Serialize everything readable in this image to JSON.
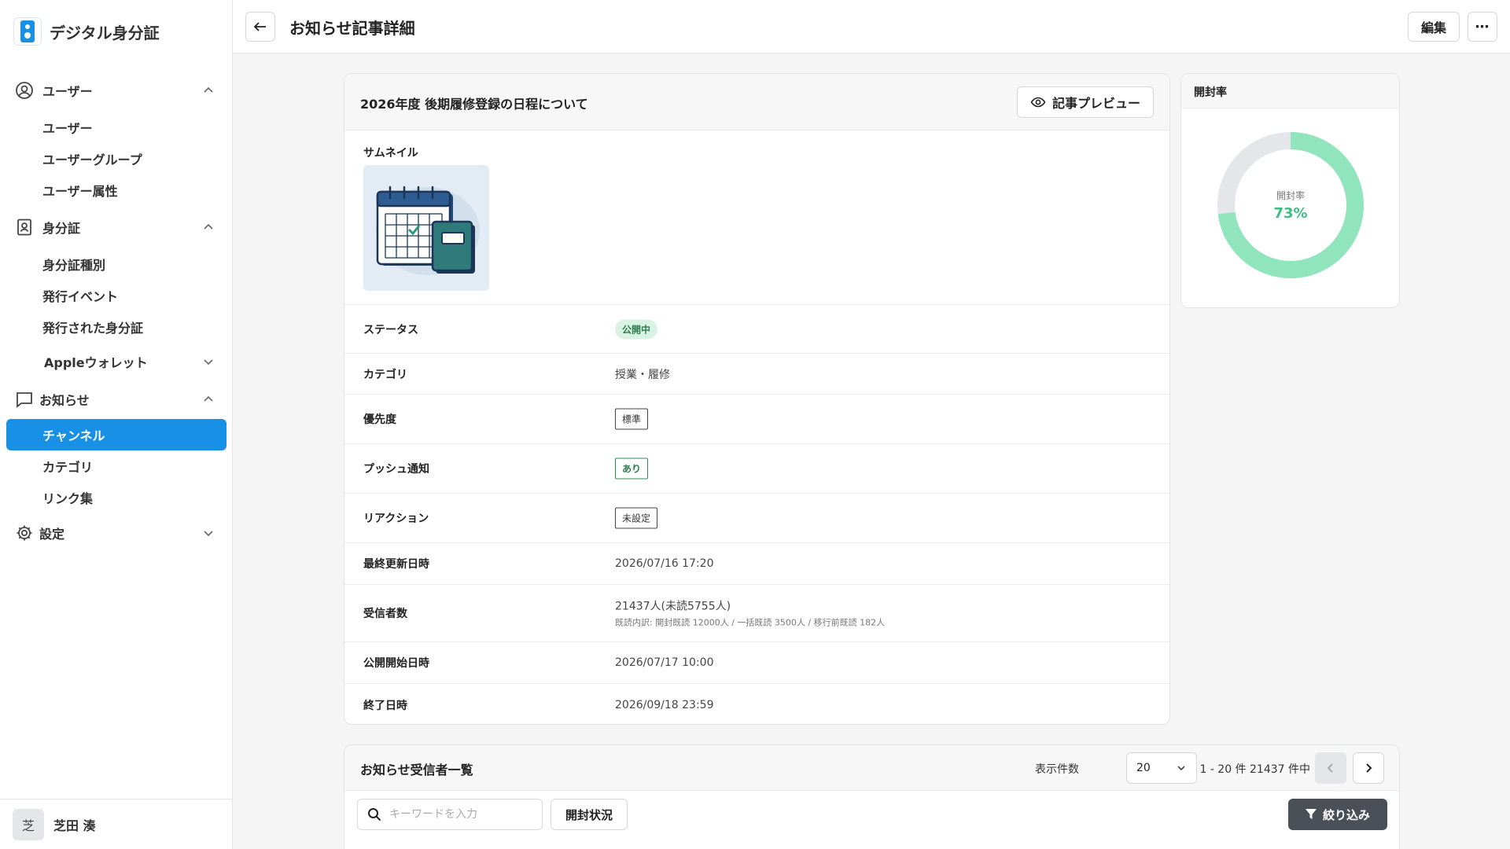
{
  "brand": {
    "name": "デジタル身分証"
  },
  "sidebar": {
    "sections": [
      {
        "label": "ユーザー",
        "icon": "user-circle-icon",
        "expanded": true
      },
      {
        "label": "身分証",
        "icon": "id-badge-icon",
        "expanded": true
      },
      {
        "label": "お知らせ",
        "icon": "message-icon",
        "expanded": true
      },
      {
        "label": "設定",
        "icon": "gear-icon",
        "expanded": false
      }
    ],
    "users_items": [
      "ユーザー",
      "ユーザーグループ",
      "ユーザー属性"
    ],
    "id_items": [
      "身分証種別",
      "発行イベント",
      "発行された身分証"
    ],
    "apple_wallet": "Appleウォレット",
    "notice_items": [
      "チャンネル",
      "カテゴリ",
      "リンク集"
    ],
    "active_item": "チャンネル",
    "accent_color": "#1890e6"
  },
  "user": {
    "avatar_initial": "芝",
    "name": "芝田 湊"
  },
  "header": {
    "title": "お知らせ記事詳細",
    "edit_label": "編集",
    "more_label": "⋯"
  },
  "article": {
    "title": "2026年度 後期履修登録の日程について",
    "preview_label": "記事プレビュー",
    "thumbnail_label": "サムネイル",
    "rows": {
      "status": {
        "label": "ステータス",
        "value": "公開中"
      },
      "category": {
        "label": "カテゴリ",
        "value": "授業・履修"
      },
      "priority": {
        "label": "優先度",
        "value": "標準"
      },
      "push": {
        "label": "プッシュ通知",
        "value": "あり"
      },
      "reaction": {
        "label": "リアクション",
        "value": "未設定"
      },
      "updated": {
        "label": "最終更新日時",
        "value": "2026/07/16 17:20"
      },
      "recipients": {
        "label": "受信者数",
        "value": "21437人(未読5755人)",
        "sub": "既読内訳: 開封既読 12000人 / 一括既読 3500人 / 移行前既読 182人"
      },
      "start": {
        "label": "公開開始日時",
        "value": "2026/07/17 10:00"
      },
      "end": {
        "label": "終了日時",
        "value": "2026/09/18 23:59"
      }
    }
  },
  "open_rate": {
    "title": "開封率",
    "center_label": "開封率",
    "value_text": "73%",
    "fraction": 0.73,
    "color": "#90e5bd",
    "track_color": "#e4e6ea"
  },
  "recipients_list": {
    "title": "お知らせ受信者一覧",
    "per_page_label": "表示件数",
    "per_page_value": "20",
    "range_label": "1 - 20 件 21437 件中",
    "search_placeholder": "キーワードを入力",
    "status_filter_label": "開封状況",
    "filter_label": "絞り込み"
  }
}
